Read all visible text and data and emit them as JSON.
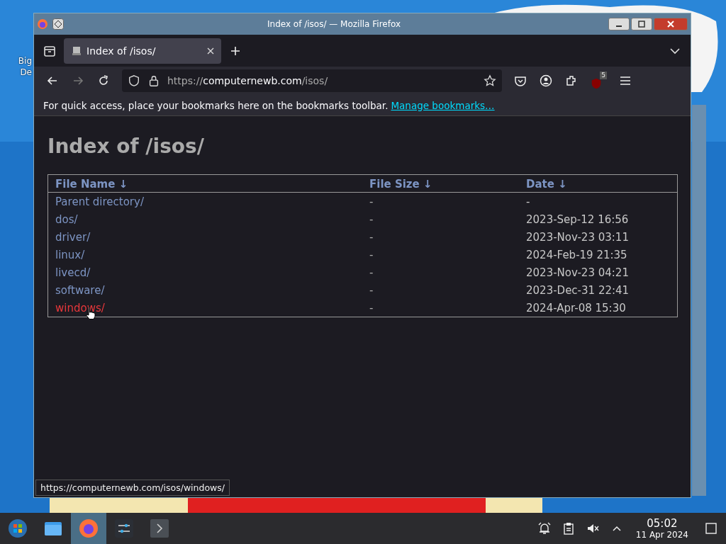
{
  "desktop_icon": {
    "label_lines": [
      "Big",
      "De"
    ]
  },
  "window": {
    "title": "Index of /isos/ — Mozilla Firefox"
  },
  "tabs": [
    {
      "label": "Index of /isos/",
      "selected": true
    }
  ],
  "address_bar": {
    "scheme": "https://",
    "domain": "computernewb.com",
    "path": "/isos/"
  },
  "extension_badge": "5",
  "bookmarks_bar": {
    "message": "For quick access, place your bookmarks here on the bookmarks toolbar.",
    "link": "Manage bookmarks…"
  },
  "page": {
    "heading": "Index of /isos/",
    "columns": [
      {
        "label": "File Name",
        "sort_arrow": "↓"
      },
      {
        "label": "File Size",
        "sort_arrow": "↓"
      },
      {
        "label": "Date",
        "sort_arrow": "↓"
      }
    ],
    "rows": [
      {
        "name": "Parent directory/",
        "size": "-",
        "date": "-",
        "hovered": false
      },
      {
        "name": "dos/",
        "size": "-",
        "date": "2023-Sep-12 16:56",
        "hovered": false
      },
      {
        "name": "driver/",
        "size": "-",
        "date": "2023-Nov-23 03:11",
        "hovered": false
      },
      {
        "name": "linux/",
        "size": "-",
        "date": "2024-Feb-19 21:35",
        "hovered": false
      },
      {
        "name": "livecd/",
        "size": "-",
        "date": "2023-Nov-23 04:21",
        "hovered": false
      },
      {
        "name": "software/",
        "size": "-",
        "date": "2023-Dec-31 22:41",
        "hovered": false
      },
      {
        "name": "windows/",
        "size": "-",
        "date": "2024-Apr-08 15:30",
        "hovered": true
      }
    ]
  },
  "status_url": "https://computernewb.com/isos/windows/",
  "taskbar": {
    "items": [
      {
        "kind": "start",
        "active": false
      },
      {
        "kind": "files",
        "active": false
      },
      {
        "kind": "firefox",
        "active": true
      },
      {
        "kind": "settings",
        "active": false
      },
      {
        "kind": "terminal",
        "active": false
      }
    ],
    "clock": {
      "time": "05:02",
      "date": "11 Apr 2024"
    }
  }
}
